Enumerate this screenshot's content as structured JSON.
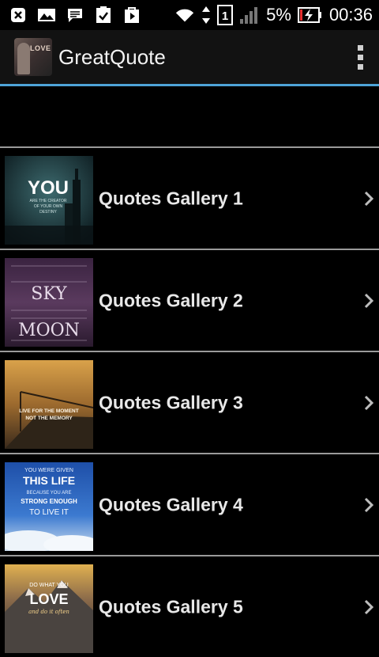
{
  "status_bar": {
    "battery_percent": "5%",
    "time": "00:36",
    "left_icons": [
      "close-notification-icon",
      "image-notification-icon",
      "message-notification-icon",
      "task-done-icon",
      "play-store-icon"
    ],
    "right_icons": [
      "wifi-icon",
      "data-arrows-icon",
      "sim-1-icon",
      "signal-icon",
      "battery-charging-icon"
    ],
    "sim_label": "1"
  },
  "action_bar": {
    "title": "GreatQuote",
    "app_icon_text": "LOVE",
    "accent_color": "#4ea3d8"
  },
  "galleries": [
    {
      "label": "Quotes Gallery 1",
      "thumb_text": [
        "YOU",
        "ARE THE CREATOR",
        "OF YOUR OWN",
        "DESTINY"
      ]
    },
    {
      "label": "Quotes Gallery 2",
      "thumb_text": [
        "SKY",
        "MOON"
      ]
    },
    {
      "label": "Quotes Gallery 3",
      "thumb_text": [
        "LIVE FOR THE MOMENT",
        "NOT THE MEMORY"
      ]
    },
    {
      "label": "Quotes Gallery 4",
      "thumb_text": [
        "YOU WERE GIVEN",
        "THIS LIFE",
        "BECAUSE YOU ARE",
        "STRONG ENOUGH",
        "TO LIVE IT"
      ]
    },
    {
      "label": "Quotes Gallery 5",
      "thumb_text": [
        "DO WHAT YOU",
        "LOVE",
        "and do it often"
      ]
    }
  ]
}
